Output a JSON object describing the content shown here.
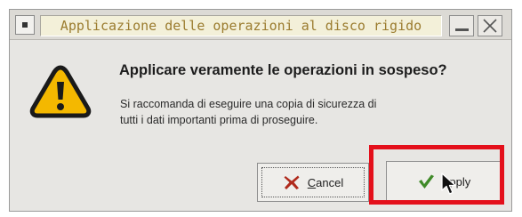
{
  "window": {
    "title": "Applicazione delle operazioni al disco rigido"
  },
  "dialog": {
    "heading": "Applicare veramente le operazioni in sospeso?",
    "message_line1": "Si raccomanda di eseguire una copia di sicurezza di",
    "message_line2": "tutti i dati importanti prima di proseguire."
  },
  "buttons": {
    "cancel": {
      "label_first": "C",
      "label_rest": "ancel",
      "icon": "x-mark-icon"
    },
    "apply": {
      "label_first": "A",
      "label_rest": "pply",
      "icon": "checkmark-icon"
    }
  },
  "colors": {
    "highlight": "#e4101b",
    "warning_fill": "#f4b800",
    "check_green": "#3f8a28",
    "cancel_red": "#b02a1c"
  }
}
